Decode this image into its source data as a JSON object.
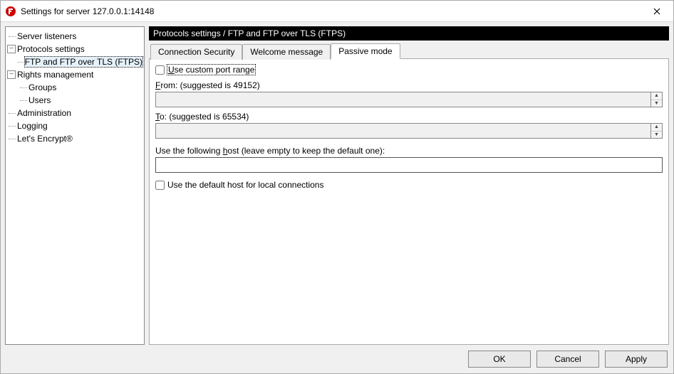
{
  "window": {
    "title": "Settings for server 127.0.0.1:14148"
  },
  "tree": {
    "items": [
      {
        "id": "server-listeners",
        "label": "Server listeners",
        "depth": 0,
        "expandable": false
      },
      {
        "id": "protocols-settings",
        "label": "Protocols settings",
        "depth": 0,
        "expandable": true,
        "expanded": true
      },
      {
        "id": "ftp-ftps",
        "label": "FTP and FTP over TLS (FTPS)",
        "depth": 1,
        "expandable": false,
        "selected": true
      },
      {
        "id": "rights-management",
        "label": "Rights management",
        "depth": 0,
        "expandable": true,
        "expanded": true
      },
      {
        "id": "groups",
        "label": "Groups",
        "depth": 1,
        "expandable": false
      },
      {
        "id": "users",
        "label": "Users",
        "depth": 1,
        "expandable": false
      },
      {
        "id": "administration",
        "label": "Administration",
        "depth": 0,
        "expandable": false
      },
      {
        "id": "logging",
        "label": "Logging",
        "depth": 0,
        "expandable": false
      },
      {
        "id": "lets-encrypt",
        "label": "Let's Encrypt®",
        "depth": 0,
        "expandable": false
      }
    ]
  },
  "breadcrumb": "Protocols settings / FTP and FTP over TLS (FTPS)",
  "tabs": {
    "items": [
      {
        "id": "conn-sec",
        "label": "Connection Security"
      },
      {
        "id": "welcome",
        "label": "Welcome message"
      },
      {
        "id": "passive",
        "label": "Passive mode",
        "active": true
      }
    ]
  },
  "form": {
    "use_custom_range_prefix": "U",
    "use_custom_range_rest": "se custom port range",
    "from_prefix": "F",
    "from_rest": "rom: (suggested is 49152)",
    "from_value": "",
    "to_prefix": "T",
    "to_rest": "o: (suggested is 65534)",
    "to_value": "",
    "host_prefix": "Use the following ",
    "host_underline": "h",
    "host_rest": "ost (leave empty to keep the default one):",
    "host_value": "",
    "default_host_label": "Use the default host for local connections"
  },
  "buttons": {
    "ok": "OK",
    "cancel": "Cancel",
    "apply": "Apply"
  }
}
